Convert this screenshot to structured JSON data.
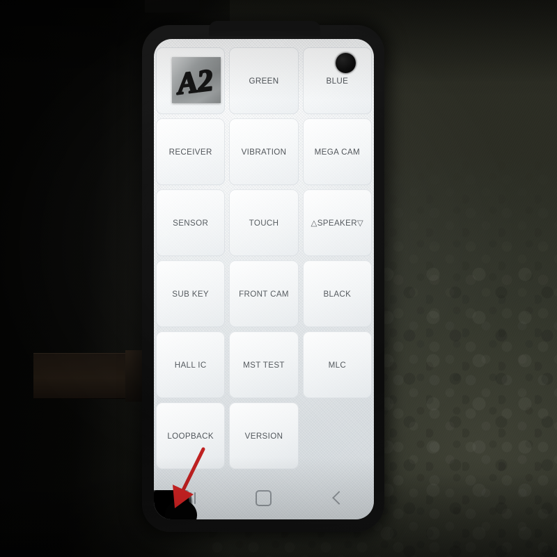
{
  "device": {
    "type": "smartphone",
    "screen_state": "diagnostic-test-menu",
    "frame_color": "#0d0d0d",
    "screen_background": "#f2f4f6"
  },
  "sticker": {
    "text": "A2",
    "description": "silver tape label handwritten in black marker",
    "color": "#9a9e9f"
  },
  "grid": {
    "columns": 3,
    "rows": 6,
    "buttons": [
      {
        "row": 1,
        "col": 1,
        "label": "",
        "covered_by_sticker": true
      },
      {
        "row": 1,
        "col": 2,
        "label": "GREEN"
      },
      {
        "row": 1,
        "col": 3,
        "label": "BLUE"
      },
      {
        "row": 2,
        "col": 1,
        "label": "RECEIVER"
      },
      {
        "row": 2,
        "col": 2,
        "label": "VIBRATION"
      },
      {
        "row": 2,
        "col": 3,
        "label": "MEGA CAM"
      },
      {
        "row": 3,
        "col": 1,
        "label": "SENSOR"
      },
      {
        "row": 3,
        "col": 2,
        "label": "TOUCH"
      },
      {
        "row": 3,
        "col": 3,
        "label": "△SPEAKER▽"
      },
      {
        "row": 4,
        "col": 1,
        "label": "SUB KEY"
      },
      {
        "row": 4,
        "col": 2,
        "label": "FRONT CAM"
      },
      {
        "row": 4,
        "col": 3,
        "label": "BLACK"
      },
      {
        "row": 5,
        "col": 1,
        "label": "HALL IC"
      },
      {
        "row": 5,
        "col": 2,
        "label": "MST TEST"
      },
      {
        "row": 5,
        "col": 3,
        "label": "MLC"
      },
      {
        "row": 6,
        "col": 1,
        "label": "LOOPBACK"
      },
      {
        "row": 6,
        "col": 2,
        "label": "VERSION"
      },
      {
        "row": 6,
        "col": 3,
        "label": "",
        "empty": true
      }
    ]
  },
  "navbar": {
    "items": [
      {
        "name": "recents",
        "icon": "recents-icon"
      },
      {
        "name": "home",
        "icon": "home-icon"
      },
      {
        "name": "back",
        "icon": "back-icon"
      }
    ],
    "icon_color": "#8d9398"
  },
  "camera": {
    "type": "punch-hole",
    "position": "top-right",
    "color": "#000000"
  },
  "annotation": {
    "type": "arrow",
    "color": "#cc2222",
    "points_to": "black blob defect at bottom-left corner of display"
  },
  "defect": {
    "description": "dark damaged spot / chipped corner on lower-left of the panel",
    "color": "#020202"
  },
  "background": {
    "surface": "dark olive pebbled concrete",
    "color": "#33362b",
    "shadow_color": "#0d0a07"
  }
}
